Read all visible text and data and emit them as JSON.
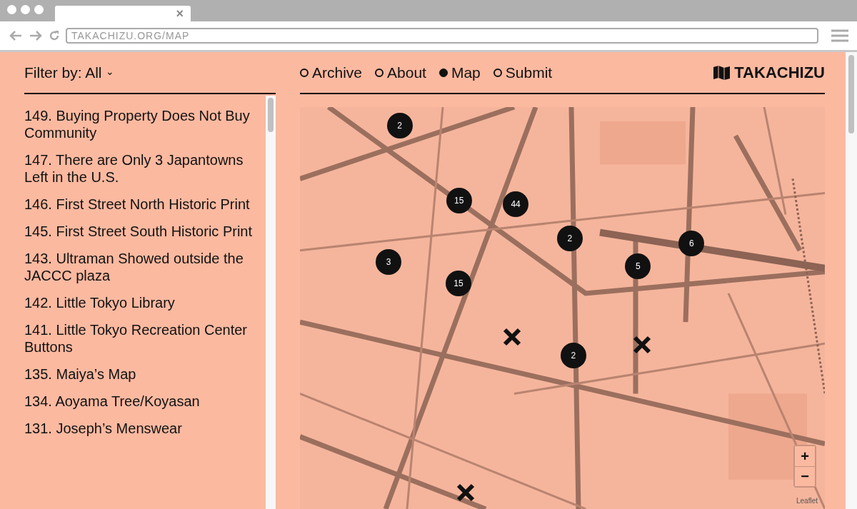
{
  "browser": {
    "url": "TAKACHIZU.ORG/MAP",
    "tab_close": "×"
  },
  "filter": {
    "label": "Filter by: All",
    "caret": "⌄"
  },
  "nav": [
    {
      "label": "Archive",
      "selected": false
    },
    {
      "label": "About",
      "selected": false
    },
    {
      "label": "Map",
      "selected": true
    },
    {
      "label": "Submit",
      "selected": false
    }
  ],
  "logo": {
    "text": "TAKACHIZU"
  },
  "stories": [
    "149. Buying Property Does Not Buy Community",
    "147. There are Only 3 Japantowns Left in the U.S.",
    "146. First Street North Historic Print",
    "145. First Street South Historic Print",
    "143. Ultraman Showed outside the JACCC plaza",
    "142. Little Tokyo Library",
    "141. Little Tokyo Recreation Center Buttons",
    "135. Maiya’s Map",
    "134. Aoyama Tree/Koyasan",
    "131. Joseph’s Menswear"
  ],
  "map": {
    "markers": [
      {
        "kind": "cluster",
        "count": "2"
      },
      {
        "kind": "cluster",
        "count": "15"
      },
      {
        "kind": "cluster",
        "count": "44"
      },
      {
        "kind": "cluster",
        "count": "2"
      },
      {
        "kind": "cluster",
        "count": "6"
      },
      {
        "kind": "cluster",
        "count": "3"
      },
      {
        "kind": "cluster",
        "count": "5"
      },
      {
        "kind": "cluster",
        "count": "15"
      },
      {
        "kind": "cluster",
        "count": "2"
      },
      {
        "kind": "point"
      },
      {
        "kind": "point"
      },
      {
        "kind": "point"
      }
    ],
    "zoom_in": "+",
    "zoom_out": "−",
    "attribution": "Leaflet"
  }
}
